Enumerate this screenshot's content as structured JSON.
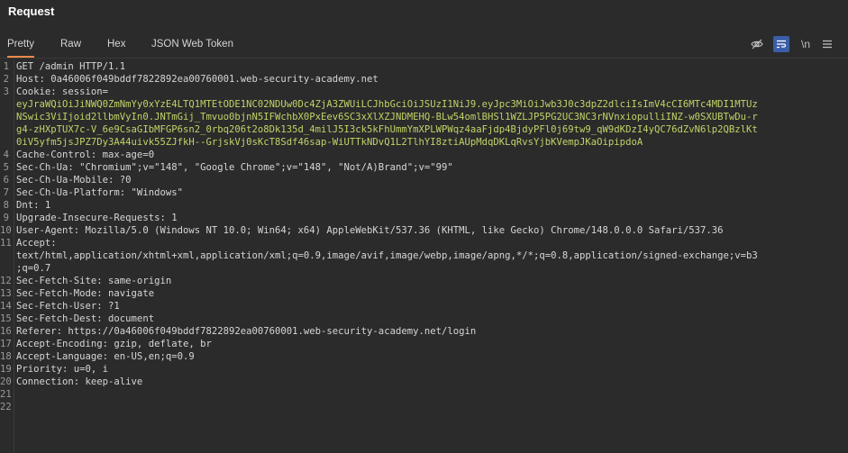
{
  "panel": {
    "title": "Request"
  },
  "tabs": [
    {
      "label": "Pretty",
      "active": true
    },
    {
      "label": "Raw",
      "active": false
    },
    {
      "label": "Hex",
      "active": false
    },
    {
      "label": "JSON Web Token",
      "active": false
    }
  ],
  "toolbar": {
    "icons": [
      "eye-off-icon",
      "wrap-lines-icon",
      "newline-icon",
      "menu-icon"
    ],
    "newline_label": "\\n",
    "accent_color": "#f0894a"
  },
  "editor": {
    "lines": [
      {
        "num": "1",
        "text": "GET /admin HTTP/1.1"
      },
      {
        "num": "2",
        "text": "Host: 0a46006f049bddf7822892ea00760001.web-security-academy.net"
      },
      {
        "num": "3",
        "text": "Cookie: session="
      },
      {
        "num": "",
        "text": "eyJraWQiOiJiNWQ0ZmNmYy0xYzE4LTQ1MTEtODE1NC02NDUw0Dc4ZjA3ZWUiLCJhbGciOiJSUzI1NiJ9.eyJpc3MiOiJwb3J0c3dpZ2dlciIsImV4cCI6MTc4MDI1MTUz",
        "cookie": true
      },
      {
        "num": "",
        "text": "NSwic3ViIjoid2llbmVyIn0.JNTmGij_Tmvuo0bjnN5IFWchbX0PxEev6SC3xXlXZJNDMEHQ-BLw54omlBHSl1WZLJP5PG2UC3NC3rNVnxiopulliINZ-w0SXUBTwDu-r",
        "cookie": true
      },
      {
        "num": "",
        "text": "g4-zHXpTUX7c-V_6e9CsaGIbMFGP6sn2_0rbq206t2o8Dk135d_4milJ5I3ck5kFhUmmYmXPLWPWqz4aaFjdp4BjdyPFl0j69tw9_qW9dKDzI4yQC76dZvN6lp2QBzlKt",
        "cookie": true
      },
      {
        "num": "",
        "text": "0iV5yfm5jsJPZ7Dy3A44uivk55ZJfkH--GrjskVj0sKcT8Sdf46sap-WiUTTkNDvQ1L2TlhYI8ztiAUpMdqDKLqRvsYjbKVempJKaOipipdoA",
        "cookie": true
      },
      {
        "num": "4",
        "text": "Cache-Control: max-age=0"
      },
      {
        "num": "5",
        "text": "Sec-Ch-Ua: \"Chromium\";v=\"148\", \"Google Chrome\";v=\"148\", \"Not/A)Brand\";v=\"99\""
      },
      {
        "num": "6",
        "text": "Sec-Ch-Ua-Mobile: ?0"
      },
      {
        "num": "7",
        "text": "Sec-Ch-Ua-Platform: \"Windows\""
      },
      {
        "num": "8",
        "text": "Dnt: 1"
      },
      {
        "num": "9",
        "text": "Upgrade-Insecure-Requests: 1"
      },
      {
        "num": "10",
        "text": "User-Agent: Mozilla/5.0 (Windows NT 10.0; Win64; x64) AppleWebKit/537.36 (KHTML, like Gecko) Chrome/148.0.0.0 Safari/537.36"
      },
      {
        "num": "11",
        "text": "Accept:"
      },
      {
        "num": "",
        "text": "text/html,application/xhtml+xml,application/xml;q=0.9,image/avif,image/webp,image/apng,*/*;q=0.8,application/signed-exchange;v=b3"
      },
      {
        "num": "",
        "text": ";q=0.7"
      },
      {
        "num": "12",
        "text": "Sec-Fetch-Site: same-origin"
      },
      {
        "num": "13",
        "text": "Sec-Fetch-Mode: navigate"
      },
      {
        "num": "14",
        "text": "Sec-Fetch-User: ?1"
      },
      {
        "num": "15",
        "text": "Sec-Fetch-Dest: document"
      },
      {
        "num": "16",
        "text": "Referer: https://0a46006f049bddf7822892ea00760001.web-security-academy.net/login"
      },
      {
        "num": "17",
        "text": "Accept-Encoding: gzip, deflate, br"
      },
      {
        "num": "18",
        "text": "Accept-Language: en-US,en;q=0.9"
      },
      {
        "num": "19",
        "text": "Priority: u=0, i"
      },
      {
        "num": "20",
        "text": "Connection: keep-alive"
      },
      {
        "num": "21",
        "text": ""
      },
      {
        "num": "22",
        "text": ""
      }
    ]
  }
}
